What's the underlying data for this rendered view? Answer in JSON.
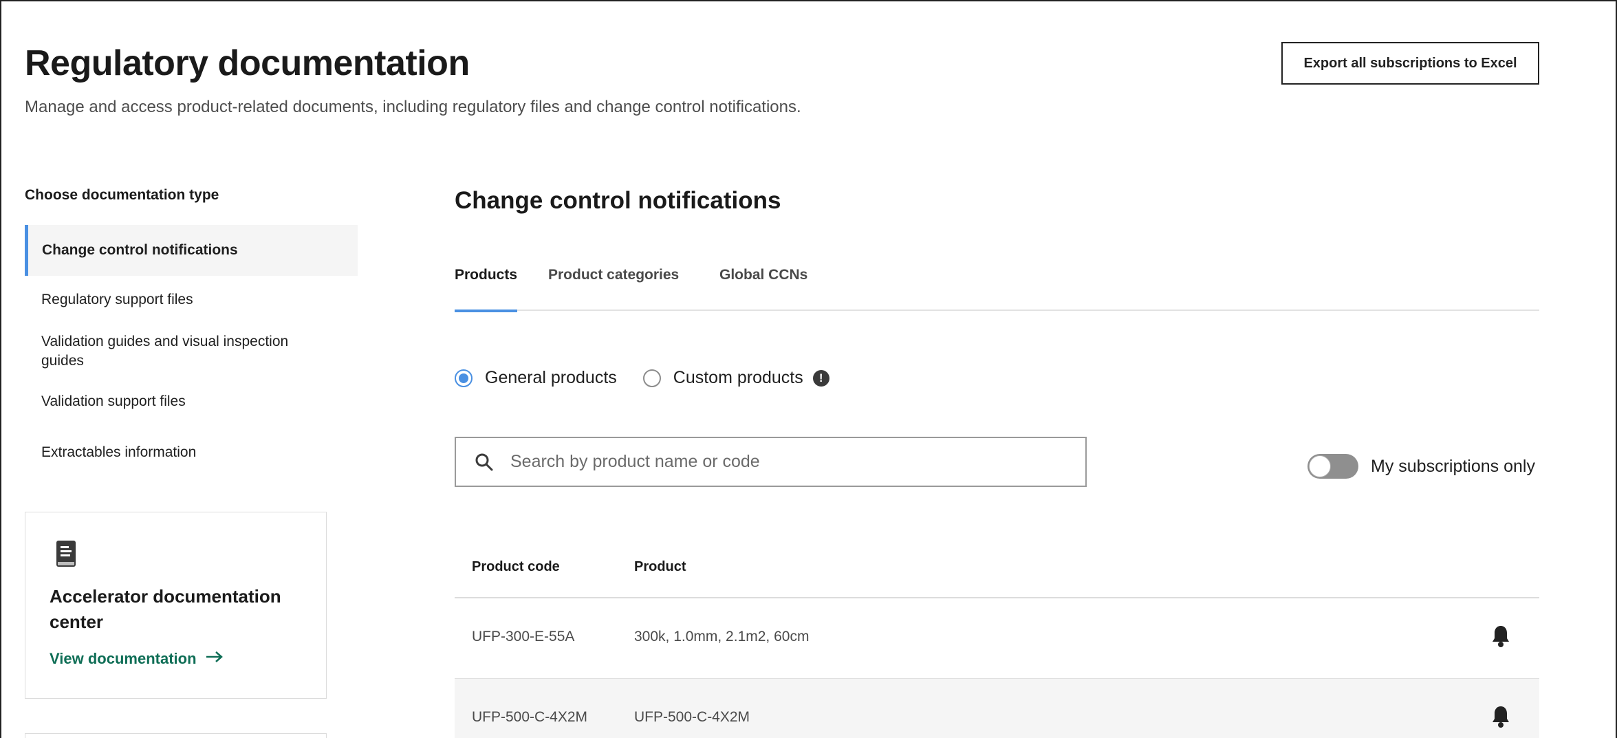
{
  "header": {
    "title": "Regulatory documentation",
    "subtitle": "Manage and access product-related documents, including regulatory files and change control notifications.",
    "export_label": "Export all subscriptions to Excel"
  },
  "sidebar": {
    "heading": "Choose documentation type",
    "items": [
      {
        "label": "Change control notifications",
        "active": true
      },
      {
        "label": "Regulatory support files",
        "active": false
      },
      {
        "label": "Validation guides and visual inspection guides",
        "active": false
      },
      {
        "label": "Validation support files",
        "active": false
      },
      {
        "label": "Extractables information",
        "active": false
      }
    ],
    "card": {
      "icon": "book-icon",
      "title": "Accelerator documentation center",
      "link_label": "View documentation"
    }
  },
  "main": {
    "title": "Change control notifications",
    "tabs": [
      {
        "label": "Products",
        "active": true
      },
      {
        "label": "Product categories",
        "active": false
      },
      {
        "label": "Global CCNs",
        "active": false
      }
    ],
    "radios": [
      {
        "label": "General products",
        "checked": true
      },
      {
        "label": "Custom products",
        "checked": false
      }
    ],
    "info_icon_glyph": "!",
    "search": {
      "placeholder": "Search by product name or code",
      "value": ""
    },
    "toggle": {
      "label": "My subscriptions only",
      "on": false
    },
    "table": {
      "columns": [
        "Product code",
        "Product"
      ],
      "rows": [
        {
          "code": "UFP-300-E-55A",
          "product": "300k, 1.0mm, 2.1m2, 60cm"
        },
        {
          "code": "UFP-500-C-4X2M",
          "product": "UFP-500-C-4X2M"
        }
      ]
    }
  },
  "colors": {
    "accent": "#4a90e2",
    "link": "#0f6e56",
    "active_bg": "#f5f5f5"
  }
}
